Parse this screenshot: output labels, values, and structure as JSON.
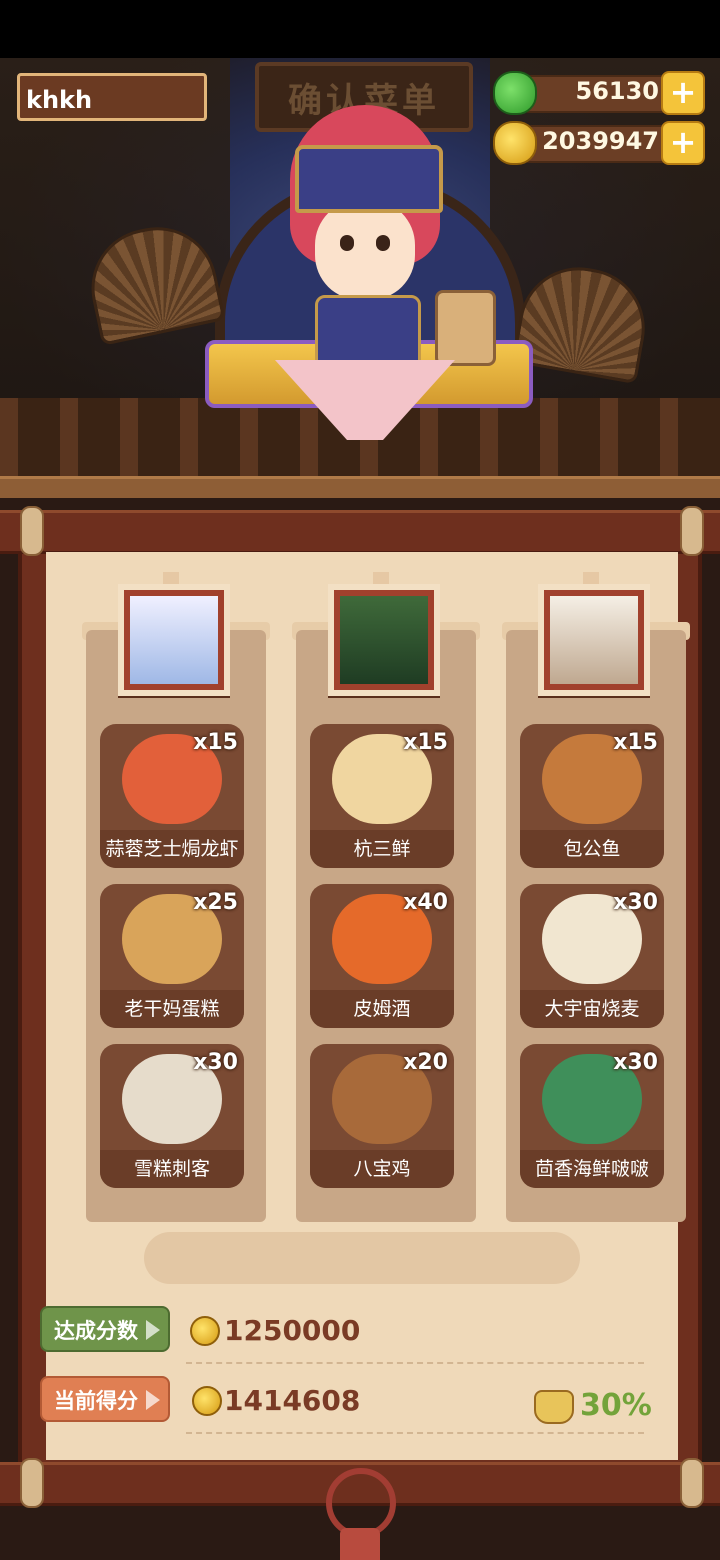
{
  "header": {
    "player_name": "khkh",
    "sign_text": "确认菜单"
  },
  "currency": {
    "jade": {
      "value": "56130",
      "icon": "jade-coin-icon"
    },
    "gold": {
      "value": "2039947",
      "icon": "gold-coin-icon"
    },
    "plus_label": "+"
  },
  "customers": [
    {
      "name": "customer-1",
      "color": "#9fb8e6"
    },
    {
      "name": "customer-2",
      "color": "#2f5a33"
    },
    {
      "name": "customer-3",
      "color": "#cdb9a1"
    }
  ],
  "dishes": [
    {
      "name": "蒜蓉芝士焗龙虾",
      "qty": "x15",
      "color": "#e2603a"
    },
    {
      "name": "杭三鲜",
      "qty": "x15",
      "color": "#f0d6a0"
    },
    {
      "name": "包公鱼",
      "qty": "x15",
      "color": "#c57a3c"
    },
    {
      "name": "老干妈蛋糕",
      "qty": "x25",
      "color": "#d9a45a"
    },
    {
      "name": "皮姆酒",
      "qty": "x40",
      "color": "#e56a2a"
    },
    {
      "name": "大宇宙烧麦",
      "qty": "x30",
      "color": "#f1e6d0"
    },
    {
      "name": "雪糕刺客",
      "qty": "x30",
      "color": "#e6dccb"
    },
    {
      "name": "八宝鸡",
      "qty": "x20",
      "color": "#a86a3a"
    },
    {
      "name": "茴香海鲜啵啵",
      "qty": "x30",
      "color": "#3f8f5a"
    }
  ],
  "scores": {
    "target_label": "达成分数",
    "target_value": "1250000",
    "current_label": "当前得分",
    "current_value": "1414608",
    "bonus": "30%"
  }
}
